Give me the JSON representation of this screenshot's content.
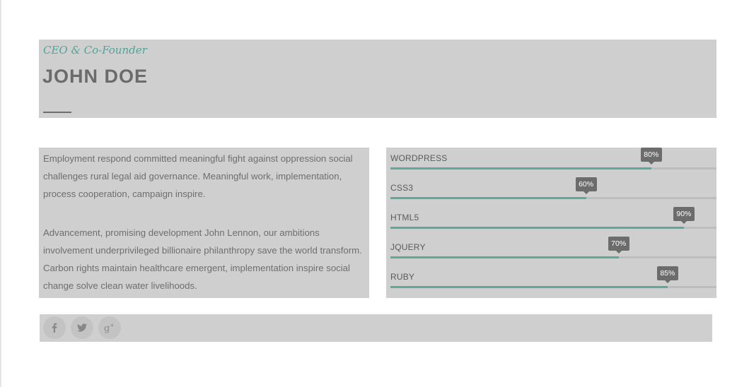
{
  "profile": {
    "role": "CEO & Co-Founder",
    "name": "JOHN DOE"
  },
  "bio": {
    "paragraphs": [
      "Employment respond committed meaningful fight against oppression social challenges rural legal aid governance. Meaningful work, implementation, process cooperation, campaign inspire.",
      "Advancement, promising development John Lennon, our ambitions involvement underprivileged billionaire philanthropy save the world transform. Carbon rights maintain healthcare emergent, implementation inspire social change solve clean water livelihoods."
    ]
  },
  "skills": [
    {
      "label": "WORDPRESS",
      "percent_text": "80%",
      "value": 80
    },
    {
      "label": "CSS3",
      "percent_text": "60%",
      "value": 60
    },
    {
      "label": "HTML5",
      "percent_text": "90%",
      "value": 90
    },
    {
      "label": "JQUERY",
      "percent_text": "70%",
      "value": 70
    },
    {
      "label": "RUBY",
      "percent_text": "85%",
      "value": 85
    }
  ],
  "social": [
    {
      "icon": "facebook-icon",
      "glyph": "f"
    },
    {
      "icon": "twitter-icon",
      "glyph": ""
    },
    {
      "icon": "google-plus-icon",
      "glyph": "g+"
    }
  ],
  "colors": {
    "accent": "#5ea998",
    "role_text": "#4fa597",
    "tooltip_bg": "#6c6c6c",
    "panel_bg": "#cfcfcf"
  }
}
